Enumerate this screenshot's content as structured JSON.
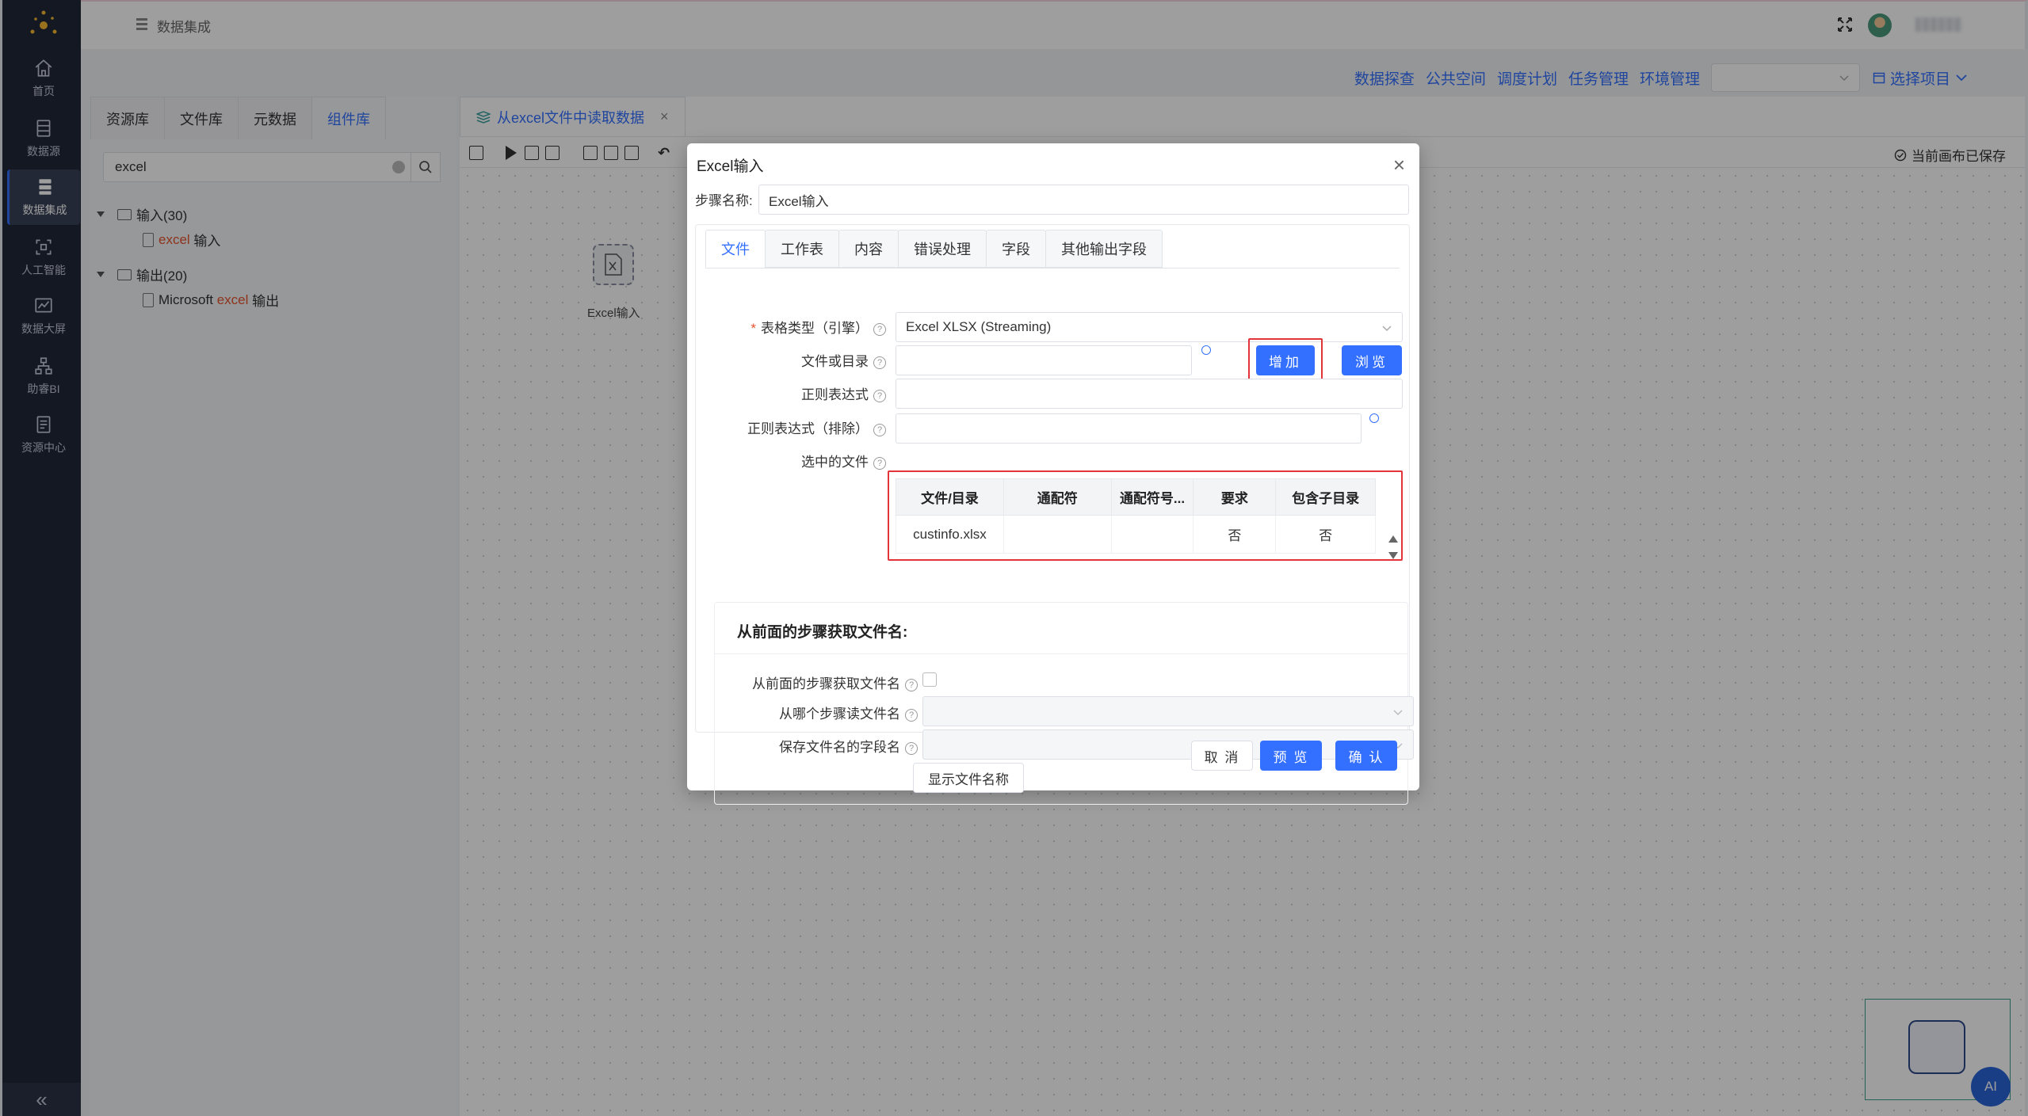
{
  "header": {
    "breadcrumb": "数据集成"
  },
  "nav": {
    "items": [
      {
        "label": "首页",
        "icon": "home-icon"
      },
      {
        "label": "数据源",
        "icon": "database-icon"
      },
      {
        "label": "数据集成",
        "icon": "integration-icon",
        "active": true
      },
      {
        "label": "人工智能",
        "icon": "ai-scan-icon"
      },
      {
        "label": "数据大屏",
        "icon": "chart-screen-icon"
      },
      {
        "label": "助睿BI",
        "icon": "org-tree-icon"
      },
      {
        "label": "资源中心",
        "icon": "resource-icon"
      }
    ],
    "collapse_label": "«"
  },
  "toplinks": [
    "数据探查",
    "公共空间",
    "调度计划",
    "任务管理",
    "环境管理"
  ],
  "project_picker": "选择项目",
  "left_panel": {
    "tabs": [
      "资源库",
      "文件库",
      "元数据",
      "组件库"
    ],
    "active_tab": 3,
    "search_value": "excel",
    "tree": {
      "input_group": "输入(30)",
      "input_item_hl": "excel",
      "input_item_rest": " 输入",
      "output_group": "输出(20)",
      "output_item_pre": "Microsoft ",
      "output_item_hl": "excel",
      "output_item_rest": " 输出"
    }
  },
  "workarea": {
    "tab_title": "从excel文件中读取数据",
    "tab_close": "×",
    "saved_status": "当前画布已保存",
    "node_label": "Excel输入",
    "ai_button": "AI"
  },
  "modal": {
    "title": "Excel输入",
    "close": "×",
    "step_name_label": "步骤名称:",
    "step_name_value": "Excel输入",
    "tabs": [
      "文件",
      "工作表",
      "内容",
      "错误处理",
      "字段",
      "其他输出字段"
    ],
    "active_tab": 0,
    "fields": {
      "sheet_type_label": "表格类型（引擎）",
      "sheet_type_value": "Excel XLSX (Streaming)",
      "file_or_dir_label": "文件或目录",
      "regex_label": "正则表达式",
      "regex_exclude_label": "正则表达式（排除）",
      "selected_files_label": "选中的文件"
    },
    "buttons": {
      "add": "增加",
      "browse": "浏览",
      "show_filenames": "显示文件名称",
      "cancel": "取 消",
      "preview": "预 览",
      "confirm": "确 认"
    },
    "files_table": {
      "columns": [
        "文件/目录",
        "通配符",
        "通配符号...",
        "要求",
        "包含子目录"
      ],
      "rows": [
        [
          "custinfo.xlsx",
          "",
          "",
          "否",
          "否"
        ]
      ]
    },
    "prev_step_section": {
      "title": "从前面的步骤获取文件名:",
      "from_prev_label": "从前面的步骤获取文件名",
      "which_step_label": "从哪个步骤读文件名",
      "field_name_label": "保存文件名的字段名"
    }
  },
  "colors": {
    "primary": "#3370ff",
    "sidebar": "#1f2739",
    "highlight_box": "#e3343a",
    "match_text": "#e5532f"
  }
}
